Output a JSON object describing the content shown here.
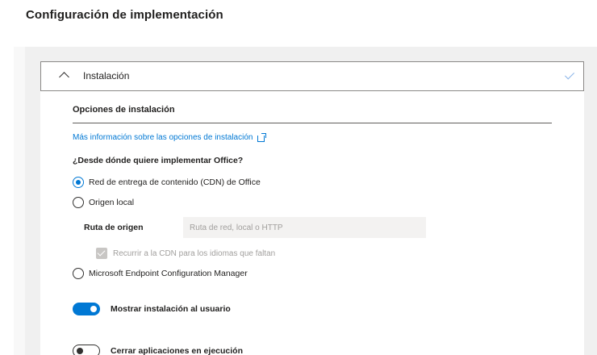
{
  "page": {
    "title": "Configuración de implementación"
  },
  "section": {
    "title": "Instalación",
    "expanded": true,
    "completed": true,
    "subsection_title": "Opciones de instalación",
    "info_link": "Más información sobre las opciones de instalación",
    "question": "¿Desde dónde quiere implementar Office?",
    "options": [
      {
        "label": "Red de entrega de contenido (CDN) de Office",
        "selected": true
      },
      {
        "label": "Origen local",
        "selected": false
      },
      {
        "label": "Microsoft Endpoint Configuration Manager",
        "selected": false
      }
    ],
    "source_path": {
      "label": "Ruta de origen",
      "placeholder": "Ruta de red, local o HTTP",
      "value": ""
    },
    "fallback_checkbox": {
      "label": "Recurrir a la CDN para los idiomas que faltan",
      "checked": true,
      "disabled": true
    },
    "toggles": [
      {
        "label": "Mostrar instalación al usuario",
        "on": true
      },
      {
        "label": "Cerrar aplicaciones en ejecución",
        "on": false
      }
    ]
  },
  "colors": {
    "accent": "#0078d4",
    "check": "#8ab4e8",
    "disabled": "#a19f9d"
  },
  "icons": [
    "chevron-up-icon",
    "checkmark-icon",
    "external-link-icon",
    "radio-icon",
    "checkbox-icon",
    "toggle-icon"
  ]
}
